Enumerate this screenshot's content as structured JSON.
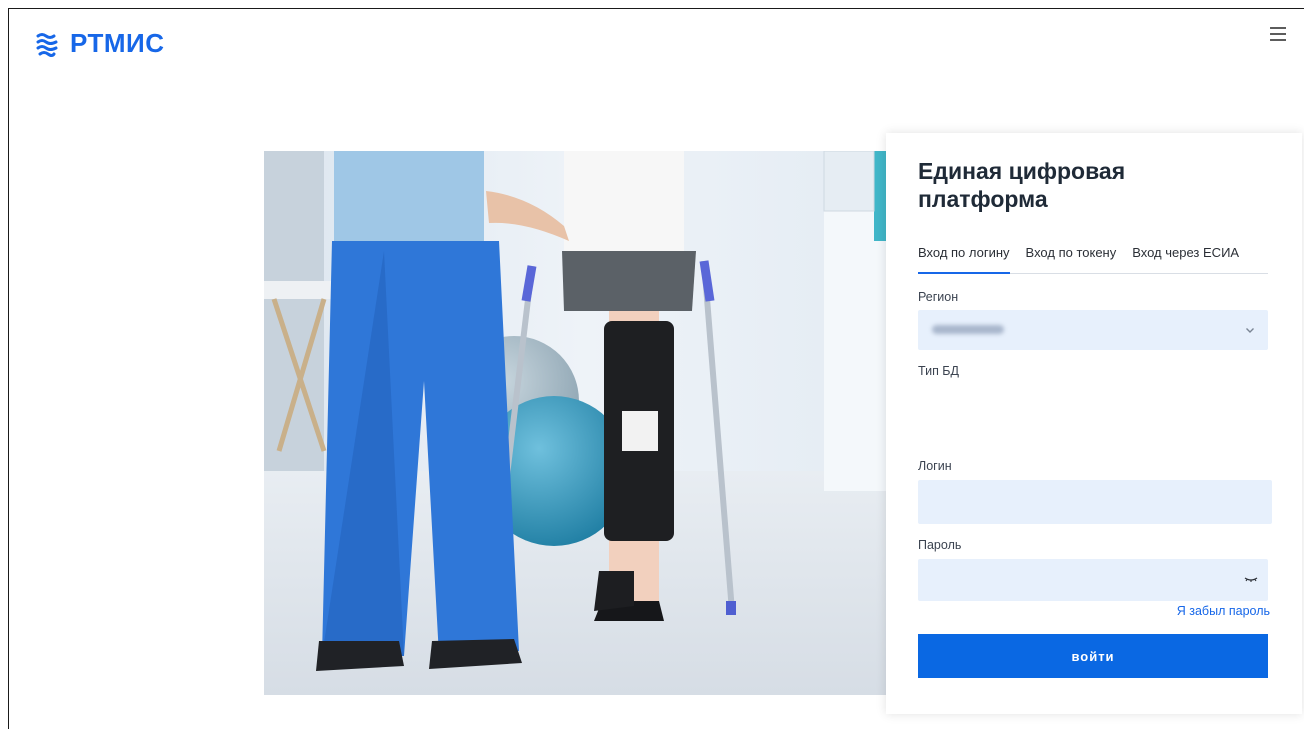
{
  "header": {
    "logo_text": "РТМИС",
    "menu_icon": "hamburger-menu-icon"
  },
  "colors": {
    "brand": "#1767e8",
    "button": "#0a68e3",
    "input_bg": "#e7f0fc"
  },
  "login": {
    "title": "Единая цифровая платформа",
    "tabs": [
      {
        "label": "Вход по логину",
        "active": true
      },
      {
        "label": "Вход по токену",
        "active": false
      },
      {
        "label": "Вход через ЕСИА",
        "active": false
      }
    ],
    "region_label": "Регион",
    "db_type_label": "Тип БД",
    "login_label": "Логин",
    "login_value": "",
    "password_label": "Пароль",
    "password_value": "",
    "forgot_password": "Я забыл пароль",
    "submit_label": "войти"
  }
}
